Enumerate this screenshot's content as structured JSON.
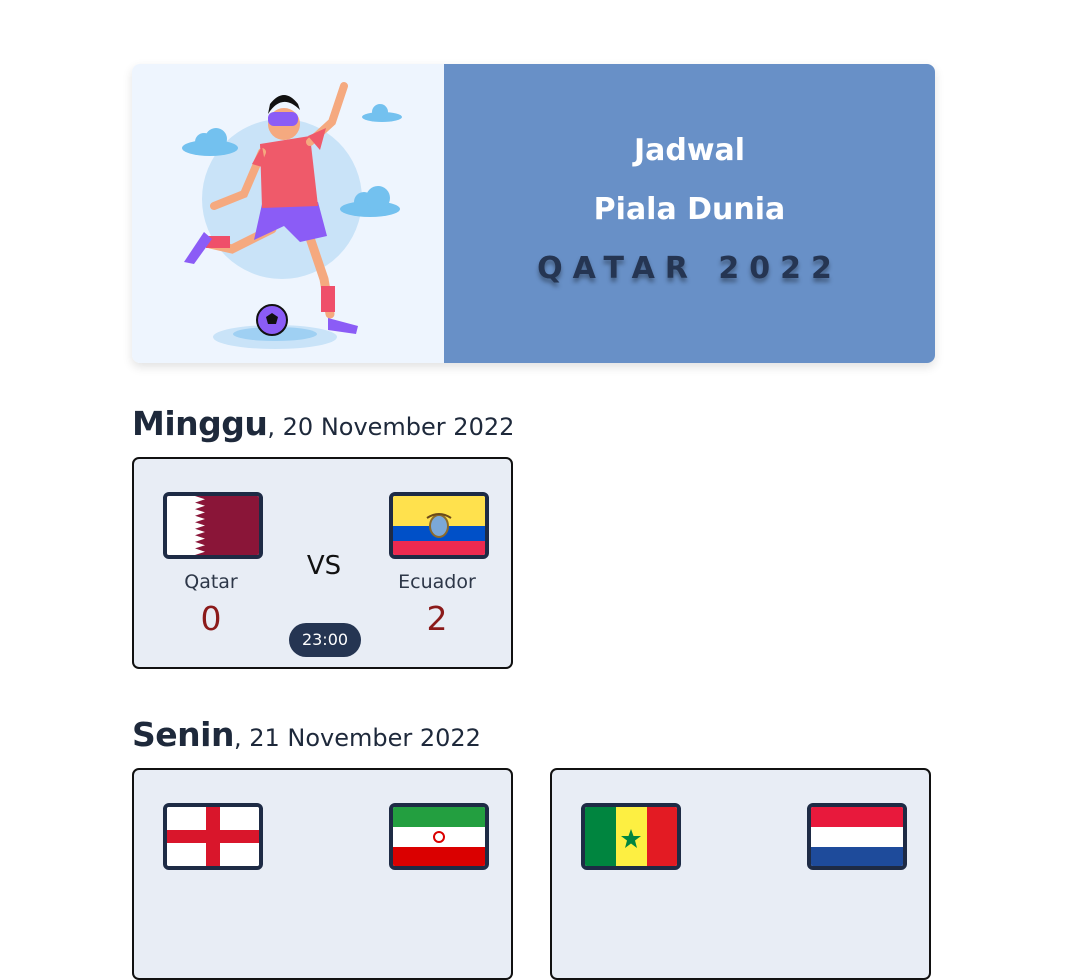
{
  "hero": {
    "line1": "Jadwal",
    "line2": "Piala Dunia",
    "line3": "QATAR 2022",
    "panel_color": "#6890c7"
  },
  "days": [
    {
      "name": "Minggu",
      "date": ", 20 November 2022",
      "matches": [
        {
          "team_a": {
            "name": "Qatar",
            "score": "0",
            "flag_icon": "qatar-flag-icon"
          },
          "vs": "VS",
          "time": "23:00",
          "team_b": {
            "name": "Ecuador",
            "score": "2",
            "flag_icon": "ecuador-flag-icon"
          }
        }
      ]
    },
    {
      "name": "Senin",
      "date": ", 21 November 2022",
      "matches": [
        {
          "team_a": {
            "flag_icon": "england-flag-icon"
          },
          "team_b": {
            "flag_icon": "iran-flag-icon"
          }
        },
        {
          "team_a": {
            "flag_icon": "senegal-flag-icon"
          },
          "team_b": {
            "flag_icon": "netherlands-flag-icon"
          }
        }
      ]
    }
  ],
  "colors": {
    "score": "#8b1a1a",
    "time_badge": "#253552",
    "card_bg": "#e8edf5"
  }
}
